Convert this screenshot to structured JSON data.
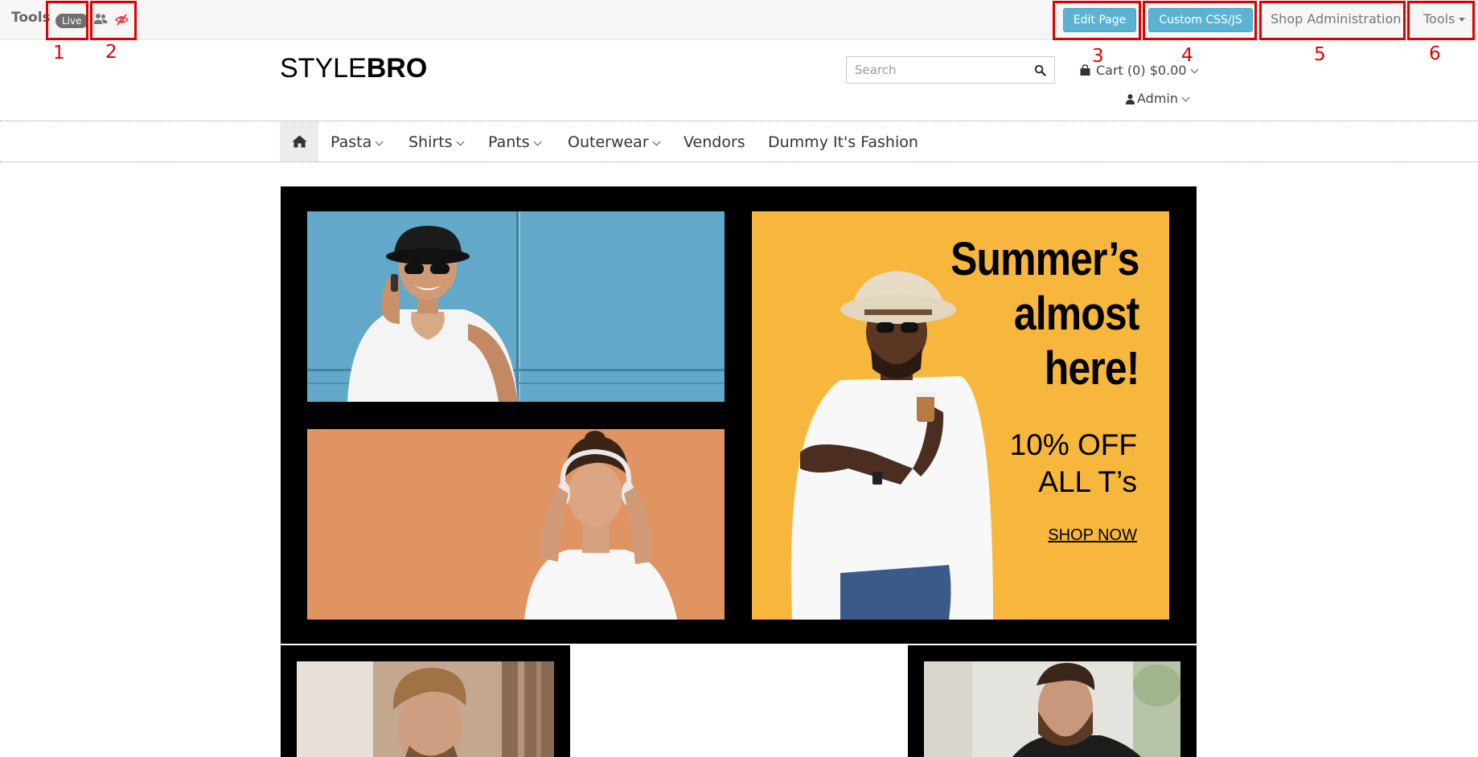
{
  "toolbar": {
    "title": "Tools",
    "status_badge": "Live",
    "users_icon": "users-icon",
    "visibility_icon": "eye-slash-icon",
    "edit_page_label": "Edit Page",
    "custom_css_label": "Custom CSS/JS",
    "shop_admin_label": "Shop Administration",
    "tools_label": "Tools",
    "accent_color": "#5bb3d4"
  },
  "annotations": [
    "1",
    "2",
    "3",
    "4",
    "5",
    "6"
  ],
  "header": {
    "logo_light": "STYLE",
    "logo_bold": "BRO",
    "search_placeholder": "Search",
    "cart_label": "Cart",
    "cart_count": "(0)",
    "cart_total": "$0.00",
    "user_label": "Admin"
  },
  "nav": {
    "home_icon": "home-icon",
    "items": [
      {
        "label": "Pasta",
        "dropdown": true
      },
      {
        "label": "Shirts",
        "dropdown": true
      },
      {
        "label": "Pants",
        "dropdown": true
      },
      {
        "label": "Outerwear",
        "dropdown": true
      },
      {
        "label": "Vendors",
        "dropdown": false
      },
      {
        "label": "Dummy It's Fashion",
        "dropdown": false
      }
    ]
  },
  "banner": {
    "headline": [
      "Summer’s",
      "almost",
      "here!"
    ],
    "offer": [
      "10% OFF",
      "ALL T’s"
    ],
    "cta": "SHOP NOW",
    "promo_color": "#f5b63a"
  }
}
